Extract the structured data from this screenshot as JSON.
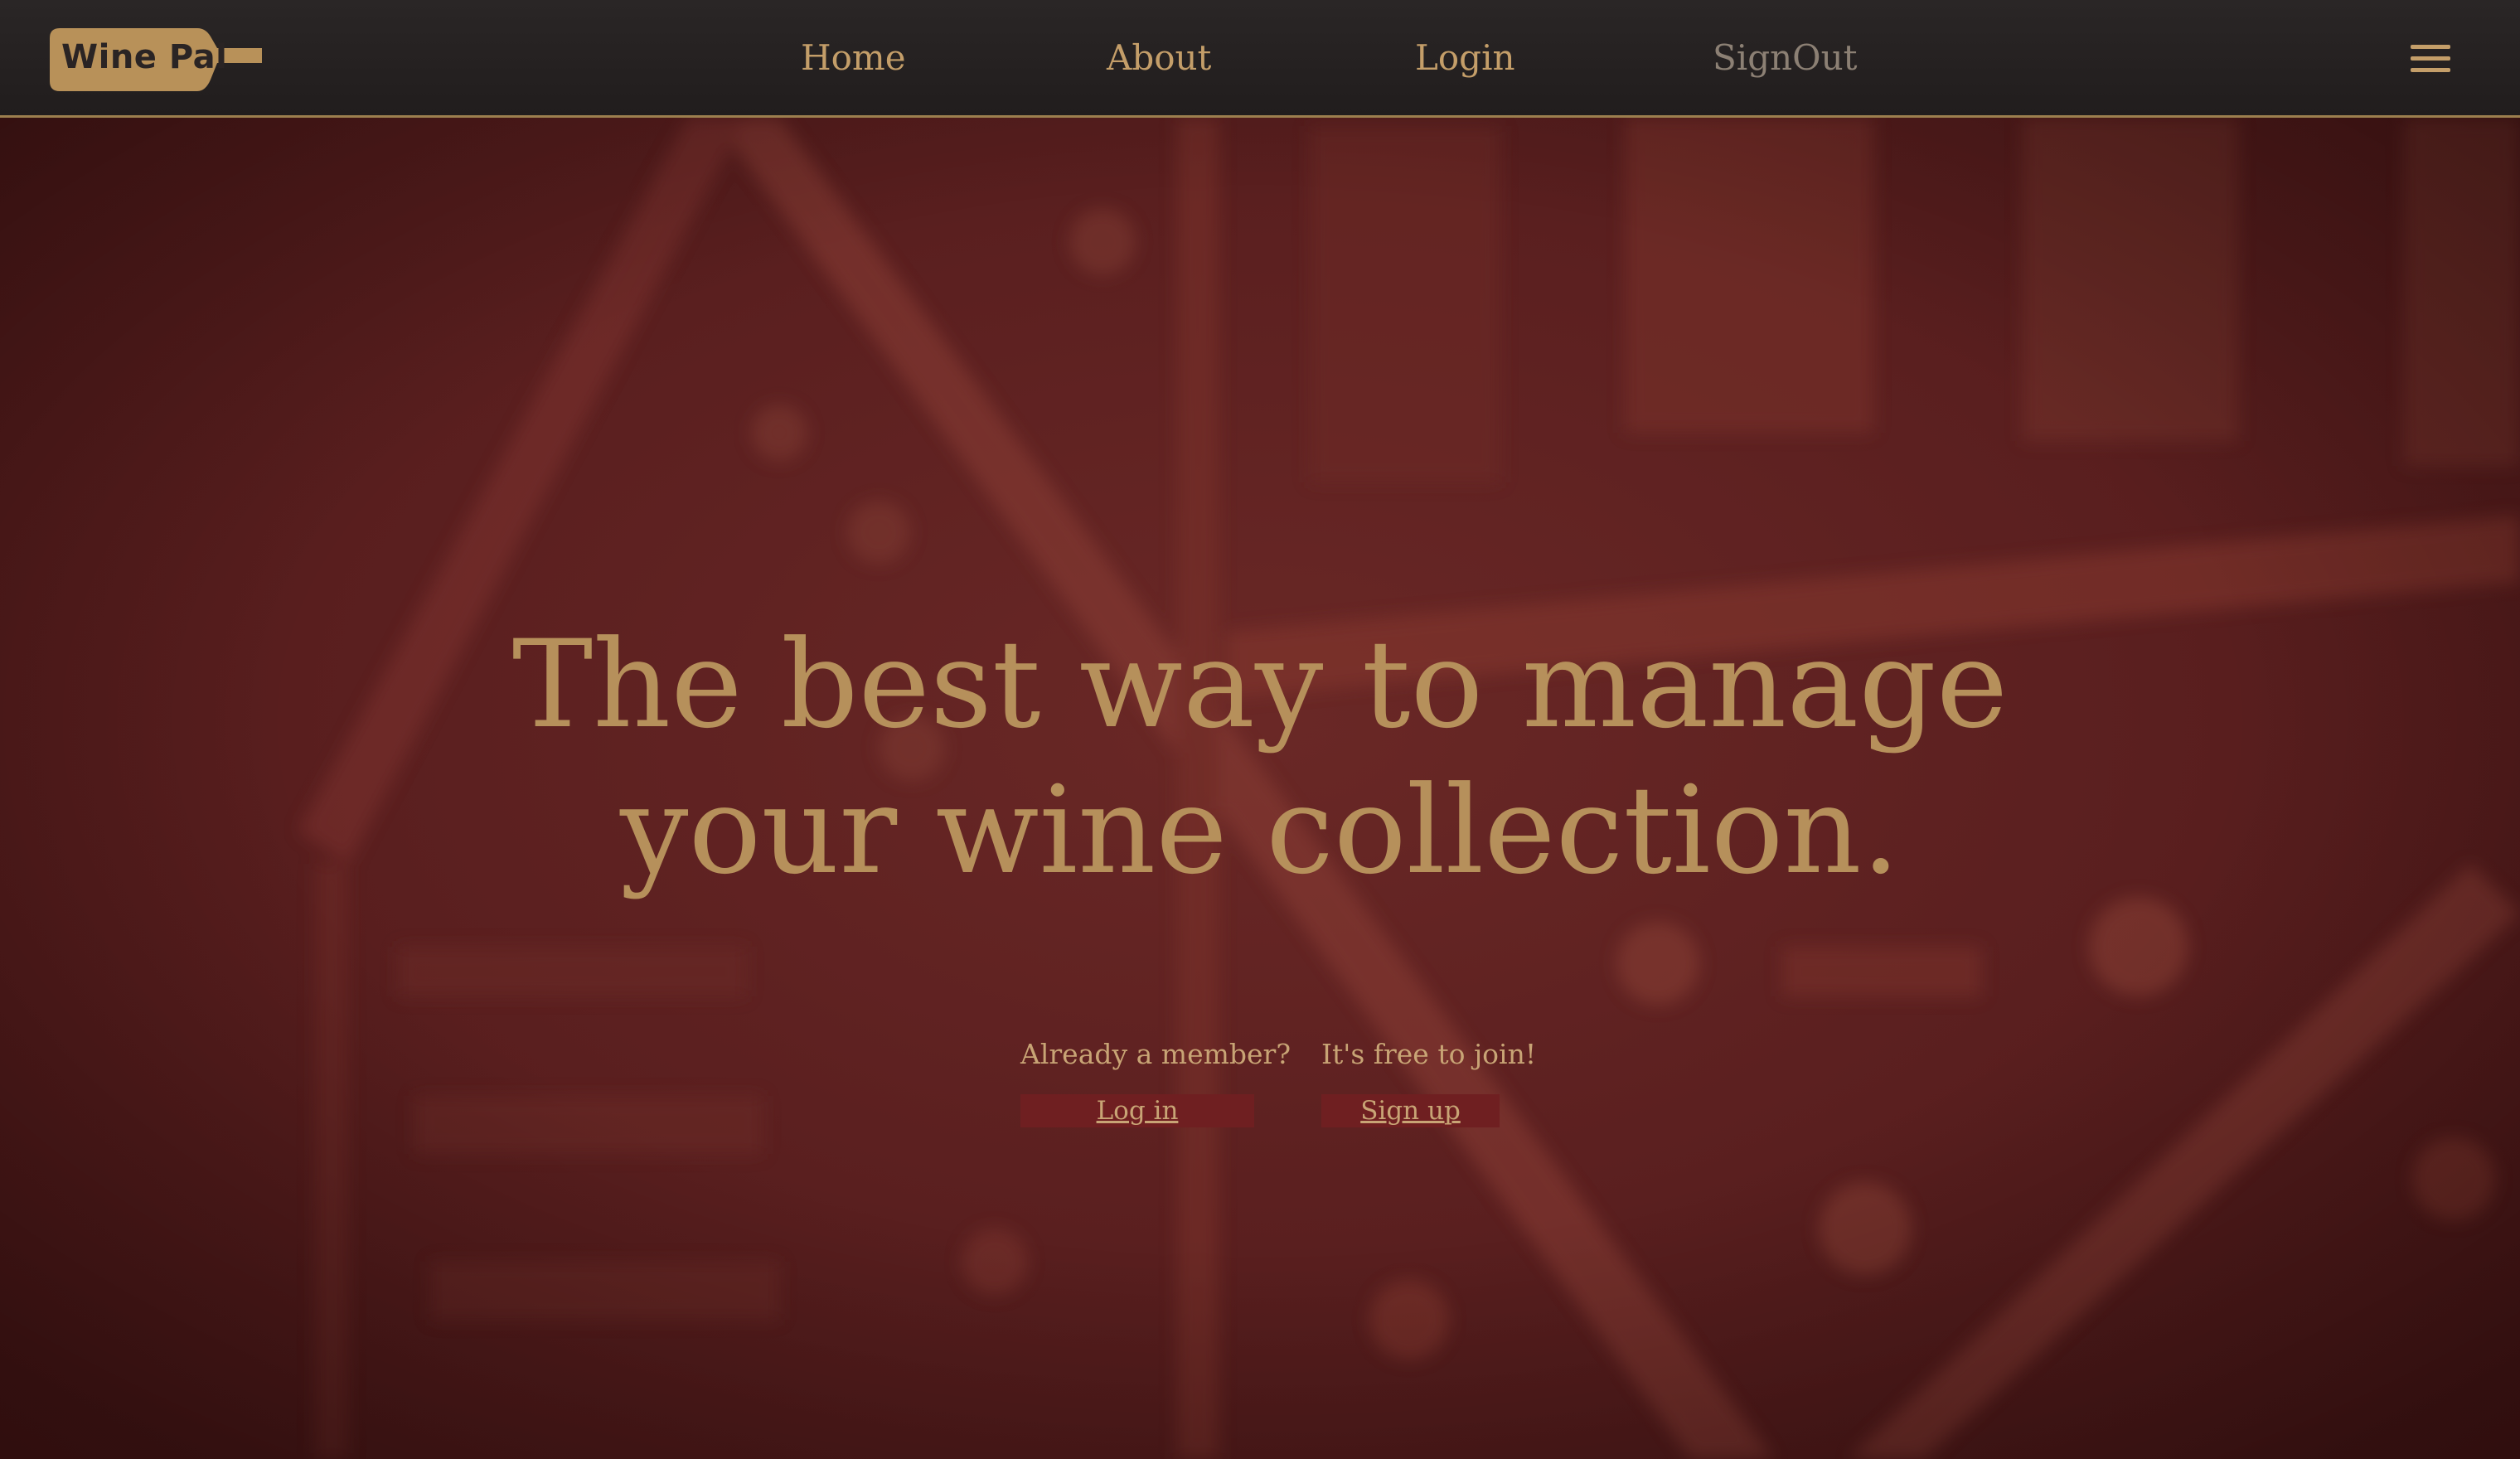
{
  "brand": {
    "name": "Wine Pal",
    "icon": "wine-bottle-logo",
    "color": "#b6905b"
  },
  "nav": {
    "links": [
      {
        "label": "Home"
      },
      {
        "label": "About"
      },
      {
        "label": "Login"
      },
      {
        "label": "SignOut"
      }
    ],
    "menu_icon": "hamburger-menu-icon"
  },
  "hero": {
    "headline_line1": "The best way to manage",
    "headline_line2": "your wine collection.",
    "member_prompt": "Already a member?",
    "login_label": "Log in",
    "join_prompt": "It's free to join!",
    "signup_label": "Sign up"
  },
  "colors": {
    "navbar_bg": "#252121",
    "accent_gold": "#c49e69",
    "hero_bg": "#5c2020",
    "button_bg": "#6f1f21"
  }
}
